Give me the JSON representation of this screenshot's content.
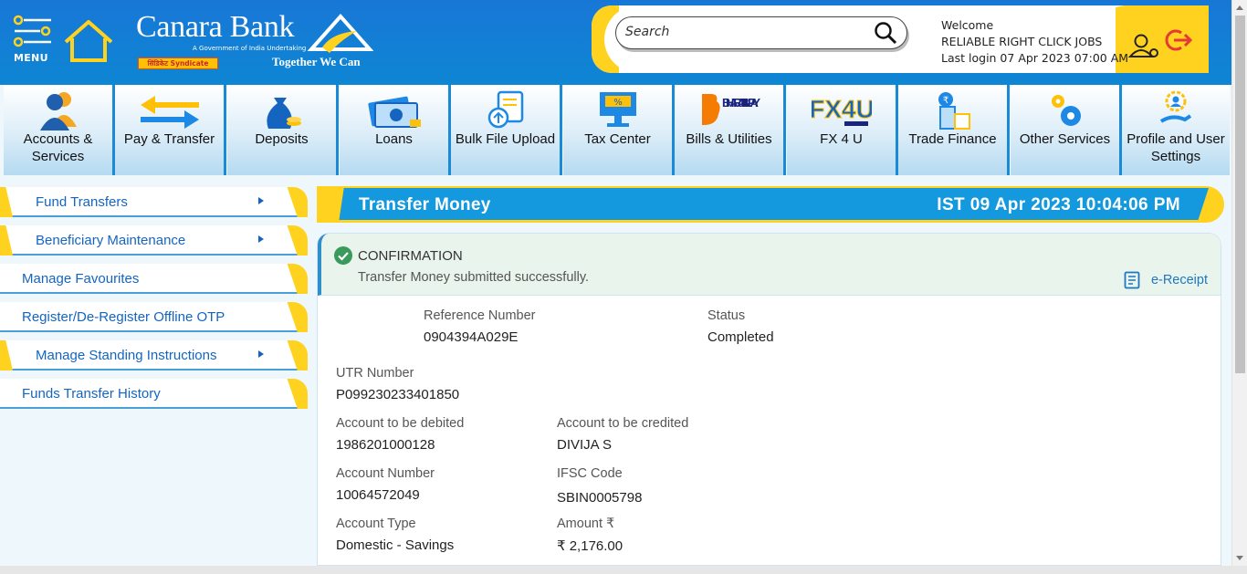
{
  "header": {
    "menu_label": "MENU",
    "bank_name": "Canara Bank",
    "bank_sub": "A Government of India Undertaking",
    "syndicate_label": "सिंडिकेट Syndicate",
    "tagline": "Together We Can",
    "search_placeholder": "Search",
    "welcome": "Welcome",
    "user_name": "RELIABLE RIGHT CLICK JOBS",
    "last_login": "Last login 07 Apr 2023 07:00 AM"
  },
  "nav": [
    {
      "label": "Accounts & Services",
      "icon": "users-icon"
    },
    {
      "label": "Pay & Transfer",
      "icon": "transfer-arrows-icon"
    },
    {
      "label": "Deposits",
      "icon": "money-bag-icon"
    },
    {
      "label": "Loans",
      "icon": "cash-icon"
    },
    {
      "label": "Bulk File Upload",
      "icon": "file-upload-icon"
    },
    {
      "label": "Tax Center",
      "icon": "tax-monitor-icon"
    },
    {
      "label": "Bills & Utilities",
      "icon": "bharat-billpay-icon"
    },
    {
      "label": "FX 4 U",
      "icon": "fx4u-icon"
    },
    {
      "label": "Trade Finance",
      "icon": "trade-finance-icon"
    },
    {
      "label": "Other Services",
      "icon": "gears-icon"
    },
    {
      "label": "Profile and User Settings",
      "icon": "profile-settings-icon"
    }
  ],
  "bharat_billpay_text": "BHARAT BILLPAY",
  "fx4u_text": "FX4U",
  "tax_symbol": "%",
  "sidebar": [
    {
      "label": "Fund Transfers",
      "has_arrow": true
    },
    {
      "label": "Beneficiary Maintenance",
      "has_arrow": true
    },
    {
      "label": "Manage Favourites",
      "has_arrow": false
    },
    {
      "label": "Register/De-Register Offline OTP",
      "has_arrow": false
    },
    {
      "label": "Manage Standing Instructions",
      "has_arrow": true
    },
    {
      "label": "Funds Transfer History",
      "has_arrow": false
    }
  ],
  "main": {
    "title": "Transfer Money",
    "datetime": "IST 09 Apr 2023 10:04:06 PM",
    "confirmation_title": "CONFIRMATION",
    "confirmation_msg": "Transfer Money submitted successfully.",
    "ereceipt": "e-Receipt",
    "fields": {
      "reference_label": "Reference Number",
      "reference_value": "0904394A029E",
      "status_label": "Status",
      "status_value": "Completed",
      "utr_label": "UTR Number",
      "utr_value": "P099230233401850",
      "debited_label": "Account to be debited",
      "debited_value": "1986201000128",
      "credited_label": "Account to be credited",
      "credited_value": "DIVIJA S",
      "account_number_label": "Account Number",
      "account_number_value": "10064572049",
      "ifsc_label": "IFSC Code",
      "ifsc_value": "SBIN0005798",
      "account_type_label": "Account Type",
      "account_type_value": "Domestic - Savings",
      "amount_label": "Amount ₹",
      "amount_value": "₹ 2,176.00"
    }
  },
  "colors": {
    "brand_blue": "#1599de",
    "brand_yellow": "#ffd21f",
    "link_blue": "#1565c0",
    "success_green": "#3a9a5b"
  }
}
